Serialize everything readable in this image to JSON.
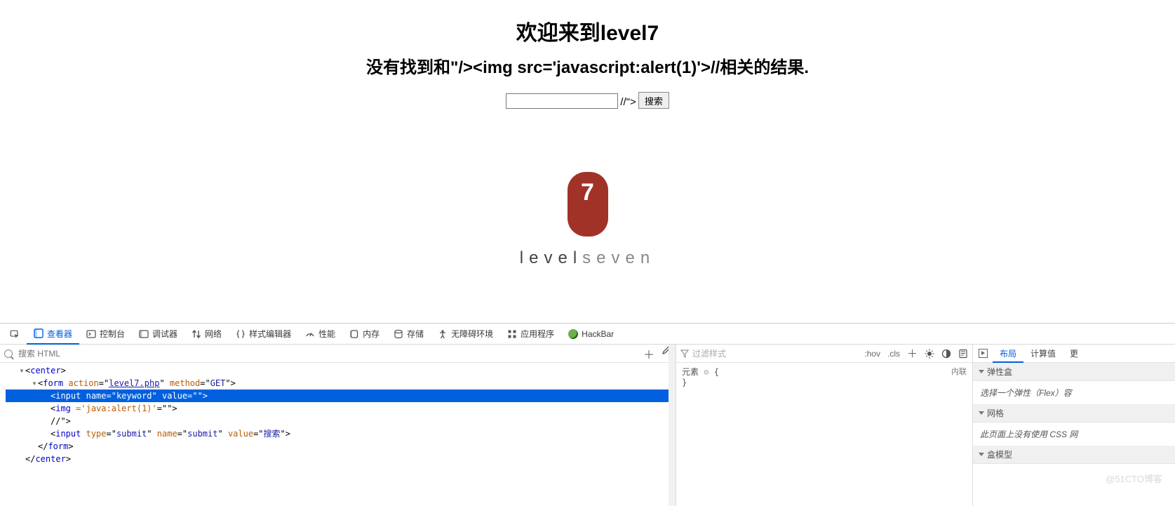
{
  "page": {
    "h1": "欢迎来到level7",
    "h2": "没有找到和\"/><img src='javascript:alert(1)'>//相关的结果.",
    "input_value": "",
    "trailing_text": "//\">",
    "submit_label": "搜索"
  },
  "logo": {
    "badge_digit": "7",
    "word_left": "level",
    "word_right": "seven"
  },
  "devtools": {
    "tabs": {
      "inspector": "查看器",
      "console": "控制台",
      "debugger": "调试器",
      "network": "网络",
      "style_editor": "样式编辑器",
      "performance": "性能",
      "memory": "内存",
      "storage": "存储",
      "accessibility": "无障碍环境",
      "application": "应用程序",
      "hackbar": "HackBar"
    },
    "dom_search_placeholder": "搜索 HTML",
    "dom_lines": {
      "l0": "<center>",
      "l1_open": "<form ",
      "l1_action_n": "action",
      "l1_action_v": "level7.php",
      "l1_method_n": "method",
      "l1_method_v": "GET",
      "l1_close": ">",
      "l2": "<input name=\"keyword\" value=\"\">",
      "l3": "<img ='java:alert(1)'=\"\">",
      "l4": "//\">",
      "l5": "<input type=\"submit\" name=\"submit\" value=\"搜索\">",
      "l6": "</form>",
      "l7": "</center>"
    },
    "rules": {
      "filter_placeholder": "过滤样式",
      "hov": ":hov",
      "cls": ".cls",
      "selector": "元素",
      "brace_open": "{",
      "brace_close": "}",
      "inline_src": "内联"
    },
    "layout": {
      "tab_layout": "布局",
      "tab_computed": "计算值",
      "tab_more": "更",
      "flex_title": "弹性盒",
      "flex_body": "选择一个弹性（Flex）容",
      "grid_title": "网格",
      "grid_body": "此页面上没有使用 CSS 网",
      "box_title": "盒模型"
    }
  },
  "watermark": "@51CTO博客"
}
